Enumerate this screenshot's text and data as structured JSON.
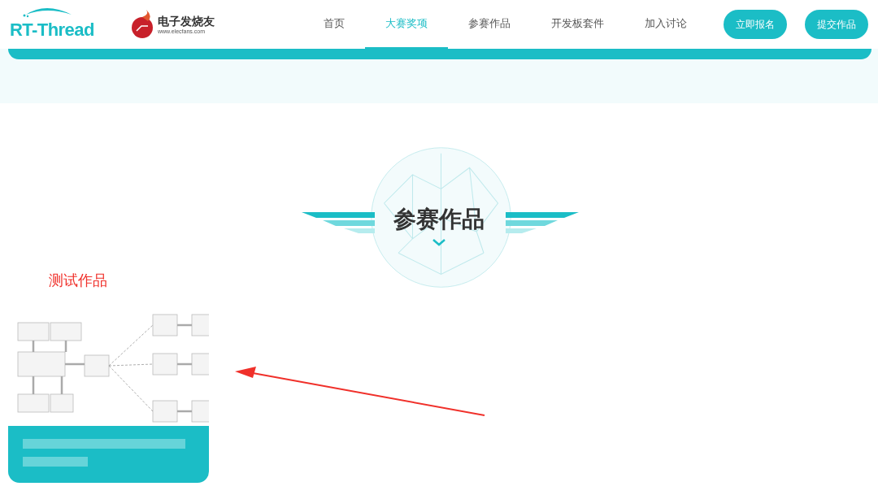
{
  "header": {
    "logo_text": "RT-Thread",
    "partner_name": "电子发烧友",
    "partner_url": "www.elecfans.com",
    "nav": [
      {
        "label": "首页",
        "selected": false
      },
      {
        "label": "大赛奖项",
        "selected": true
      },
      {
        "label": "参赛作品",
        "selected": false
      },
      {
        "label": "开发板套件",
        "selected": false
      },
      {
        "label": "加入讨论",
        "selected": false
      }
    ],
    "buttons": [
      "立即报名",
      "提交作品"
    ]
  },
  "section": {
    "title": "参赛作品"
  },
  "works": [
    {
      "title": "测试作品",
      "kind": "picture"
    }
  ]
}
